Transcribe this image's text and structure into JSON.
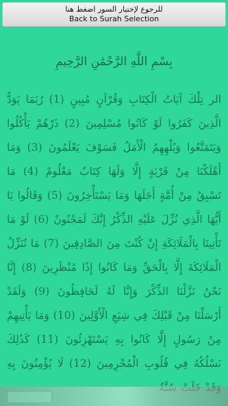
{
  "header": {
    "back_label_ar": "للرجوع لإختيار السور اضغط هنا",
    "back_label_en": "Back to Surah Selection"
  },
  "surah": {
    "basmala": "بِسْمِ اللَّهِ الرَّحْمَٰنِ الرَّحِيمِ",
    "text": "الر تِلْكَ آيَاتُ الْكِتَابِ وَقُرْآنٍ مُبِينٍ (1) رُبَمَا يَوَدُّ الَّذِينَ كَفَرُوا لَوْ كَانُوا مُسْلِمِينَ (2) ذَرْهُمْ يَأْكُلُوا وَيَتَمَتَّعُوا وَيُلْهِهِمُ الْأَمَلُ فَسَوْفَ يَعْلَمُونَ (3) وَمَا أَهْلَكْنَا مِنْ قَرْيَةٍ إِلَّا وَلَهَا كِتَابٌ مَعْلُومٌ (4) مَا تَسْبِقُ مِنْ أُمَّةٍ أَجَلَهَا وَمَا يَسْتَأْخِرُونَ (5) وَقَالُوا يَا أَيُّهَا الَّذِي نُزِّلَ عَلَيْهِ الذِّكْرُ إِنَّكَ لَمَجْنُونٌ (6) لَوْ مَا تَأْتِينَا بِالْمَلَائِكَةِ إِنْ كُنْتَ مِنَ الصَّادِقِينَ (7) مَا نُنَزِّلُ الْمَلَائِكَةَ إِلَّا بِالْحَقِّ وَمَا كَانُوا إِذًا مُنْظَرِينَ (8) إِنَّا نَحْنُ نَزَّلْنَا الذِّكْرَ وَإِنَّا لَهُ لَحَافِظُونَ (9) وَلَقَدْ أَرْسَلْنَا مِنْ قَبْلِكَ فِي شِيَعِ الْأَوَّلِينَ (10) وَمَا يَأْتِيهِمْ مِنْ رَسُولٍ إِلَّا كَانُوا بِهِ يَسْتَهْزِئُونَ (11) كَذَٰلِكَ نَسْلُكُهُ فِي قُلُوبِ الْمُجْرِمِينَ (12) لَا يُؤْمِنُونَ بِهِ وَقَدْ خَلَتْ سُنَّةُ"
  },
  "colors": {
    "background": "#2fd79a",
    "text": "#137a4c",
    "button": "#e6e6e6"
  }
}
